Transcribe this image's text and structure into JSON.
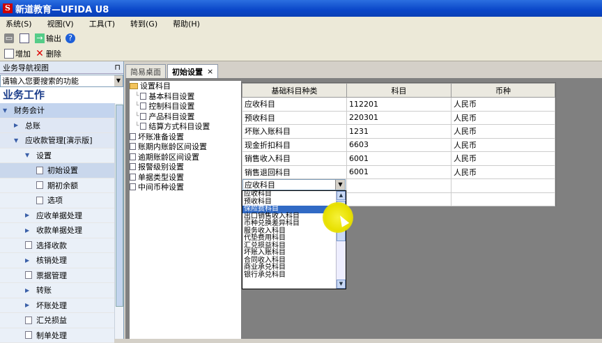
{
  "window": {
    "title": "新道教育—UFIDA U8",
    "logo": "S"
  },
  "menu": [
    "系统(S)",
    "视图(V)",
    "工具(T)",
    "转到(G)",
    "帮助(H)"
  ],
  "toolbar1": {
    "export_label": "输出"
  },
  "toolbar2": {
    "add_label": "增加",
    "delete_label": "删除"
  },
  "left_panel": {
    "header": "业务导航视图",
    "pin": "⊓",
    "search_placeholder": "请输入您要搜索的功能",
    "title": "业务工作",
    "items": [
      {
        "label": "财务会计"
      },
      {
        "label": "总账"
      },
      {
        "label": "应收款管理[演示版]"
      },
      {
        "label": "设置"
      },
      {
        "label": "初始设置"
      },
      {
        "label": "期初余额"
      },
      {
        "label": "选项"
      },
      {
        "label": "应收单据处理"
      },
      {
        "label": "收款单据处理"
      },
      {
        "label": "选择收款"
      },
      {
        "label": "核销处理"
      },
      {
        "label": "票据管理"
      },
      {
        "label": "转账"
      },
      {
        "label": "坏账处理"
      },
      {
        "label": "汇兑损益"
      },
      {
        "label": "制单处理"
      }
    ]
  },
  "tabs": [
    {
      "label": "简易桌面"
    },
    {
      "label": "初始设置",
      "close": "×"
    }
  ],
  "tree": {
    "root": "设置科目",
    "children": [
      "基本科目设置",
      "控制科目设置",
      "产品科目设置",
      "结算方式科目设置"
    ],
    "others": [
      "坏账准备设置",
      "账期内账龄区间设置",
      "逾期账龄区间设置",
      "报警级别设置",
      "单据类型设置",
      "中间币种设置"
    ]
  },
  "grid": {
    "headers": [
      "基础科目种类",
      "科目",
      "币种"
    ],
    "rows": [
      [
        "应收科目",
        "112201",
        "人民币"
      ],
      [
        "预收科目",
        "220301",
        "人民币"
      ],
      [
        "坏账入账科目",
        "1231",
        "人民币"
      ],
      [
        "现金折扣科目",
        "6603",
        "人民币"
      ],
      [
        "销售收入科目",
        "6001",
        "人民币"
      ],
      [
        "销售退回科目",
        "6001",
        "人民币"
      ]
    ]
  },
  "combo": {
    "value": "应收科目"
  },
  "dropdown": {
    "options": [
      "应收科目",
      "预收科目",
      "保险费科目",
      "出口销售收入科目",
      "币种兑换差异科目",
      "服务收入科目",
      "代垫费用科目",
      "汇兑损益科目",
      "坏账入账科目",
      "合同收入科目",
      "商业承兑科目",
      "银行承兑科目"
    ],
    "selected_index": 2
  }
}
